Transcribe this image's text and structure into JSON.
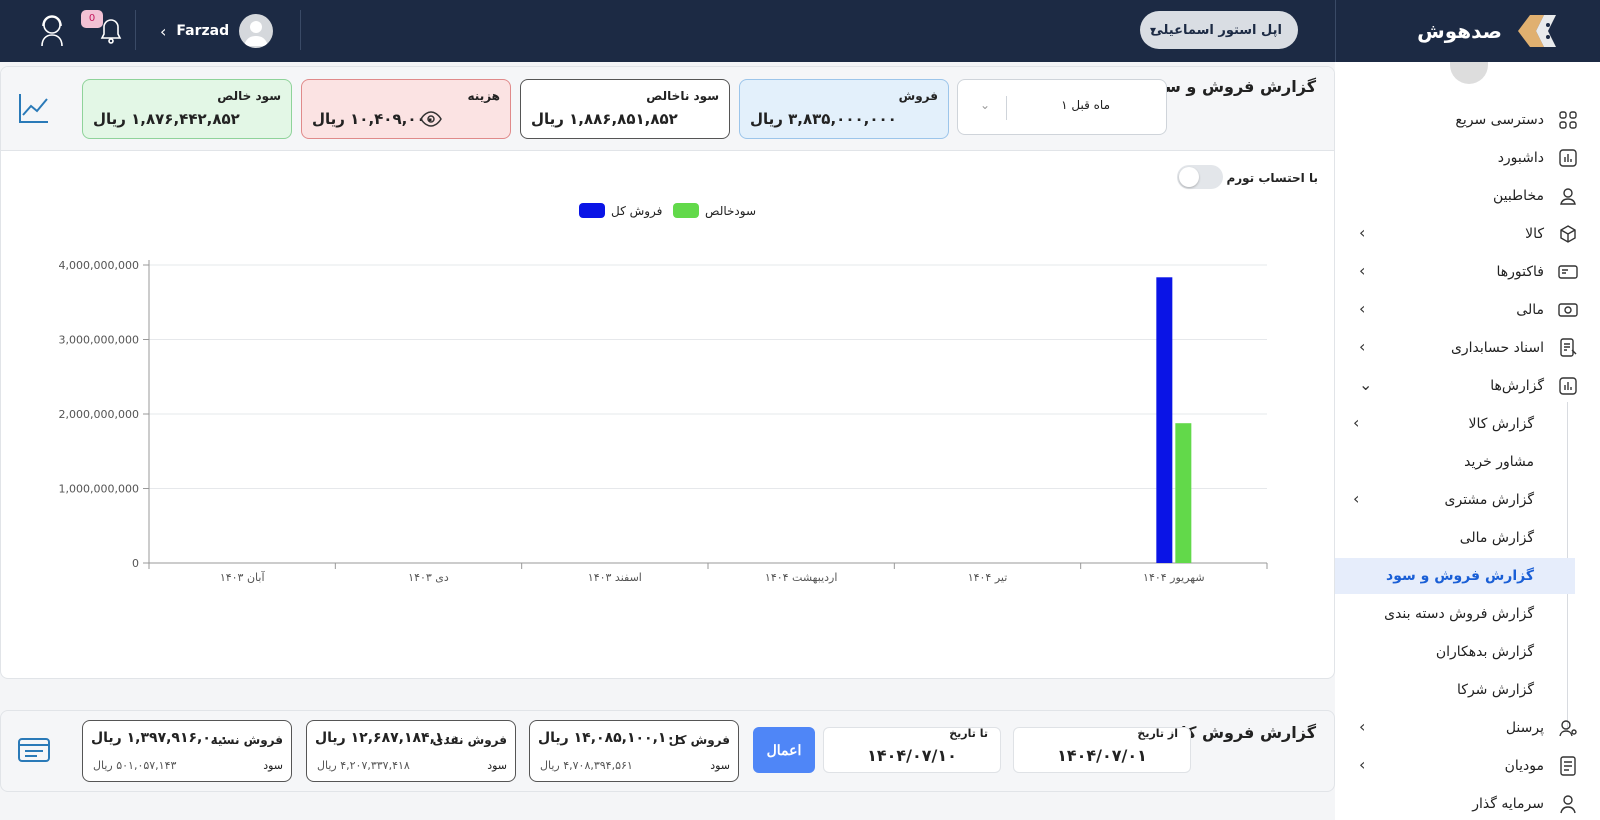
{
  "brand": {
    "name": "صدهوش"
  },
  "header": {
    "store": "اپل استور اسماعیلی",
    "user_name": "Farzad",
    "notif_badge": "0"
  },
  "sidebar": {
    "items": [
      {
        "label": "دسترسی سریع",
        "icon": "grid-icon"
      },
      {
        "label": "داشبورد",
        "icon": "chart-icon"
      },
      {
        "label": "مخاطبین",
        "icon": "user-icon"
      },
      {
        "label": "کالا",
        "icon": "box-icon"
      },
      {
        "label": "فاکتورها",
        "icon": "invoice-icon"
      },
      {
        "label": "مالی",
        "icon": "money-icon"
      },
      {
        "label": "اسناد حسابداری",
        "icon": "document-icon"
      },
      {
        "label": "گزارش‌ها",
        "icon": "report-icon"
      }
    ],
    "report_subitems": [
      "گزارش کالا",
      "مشاور خرید",
      "گزارش مشتری",
      "گزارش مالی",
      "گزارش فروش و سود",
      "گزارش فروش دسته بندی",
      "گزارش بدهکاران",
      "گزارش شرکا"
    ],
    "bottom_items": [
      {
        "label": "پرسنل",
        "icon": "staff-icon"
      },
      {
        "label": "مودیان",
        "icon": "tax-icon"
      },
      {
        "label": "سرمایه گذار",
        "icon": "investor-icon"
      }
    ],
    "active": "گزارش فروش و سود"
  },
  "report": {
    "title": "گزارش فروش و سود",
    "period": "۱ ماه قبل",
    "stats": {
      "sales": {
        "label": "فروش",
        "value": "۳,۸۳۵,۰۰۰,۰۰۰ ریال",
        "color": "#e3f0fb"
      },
      "gross": {
        "label": "سود ناخالص",
        "value": "۱,۸۸۶,۸۵۱,۸۵۲ ریال",
        "color": "#ffffff"
      },
      "cost": {
        "label": "هزینه",
        "value": "۱۰,۴۰۹,۰۰۰ ریال",
        "color": "#fbe3e3"
      },
      "net": {
        "label": "سود خالص",
        "value": "۱,۸۷۶,۴۴۲,۸۵۲ ریال",
        "color": "#e3f7e6"
      }
    },
    "inflation_toggle": "با احتساب تورم"
  },
  "chart_data": {
    "type": "bar",
    "categories": [
      "آبان ۱۴۰۳",
      "دی ۱۴۰۳",
      "اسفند ۱۴۰۳",
      "اردیبهشت ۱۴۰۴",
      "تیر ۱۴۰۴",
      "شهریور ۱۴۰۴"
    ],
    "series": [
      {
        "name": "فروش کل",
        "color": "#0a14e6",
        "values": [
          0,
          0,
          0,
          0,
          0,
          3835000000
        ]
      },
      {
        "name": "سودخالص",
        "color": "#62d94a",
        "values": [
          0,
          0,
          0,
          0,
          0,
          1876442852
        ]
      }
    ],
    "yticks": [
      "0",
      "1,000,000,000",
      "2,000,000,000",
      "3,000,000,000",
      "4,000,000,000"
    ],
    "ylim": [
      0,
      4000000000
    ],
    "grid": true,
    "legend_position": "top-center"
  },
  "summary": {
    "title": "گزارش فروش کل",
    "from_label": "از تاریخ",
    "from_value": "۱۴۰۴/۰۷/۰۱",
    "to_label": "تا تاریخ",
    "to_value": "۱۴۰۴/۰۷/۱۰",
    "apply": "اعمال",
    "boxes": [
      {
        "label": "فروش کل",
        "value": "۱۴,۰۸۵,۱۰۰,۱۰۰ ریال",
        "profit_label": "سود",
        "profit_value": "۴,۷۰۸,۳۹۴,۵۶۱ ریال"
      },
      {
        "label": "فروش نقدی",
        "value": "۱۲,۶۸۷,۱۸۴,۱۰۰ ریال",
        "profit_label": "سود",
        "profit_value": "۴,۲۰۷,۳۳۷,۴۱۸ ریال"
      },
      {
        "label": "فروش نسیه",
        "value": "۱,۳۹۷,۹۱۶,۰۰۰ ریال",
        "profit_label": "سود",
        "profit_value": "۵۰۱,۰۵۷,۱۴۳ ریال"
      }
    ]
  }
}
